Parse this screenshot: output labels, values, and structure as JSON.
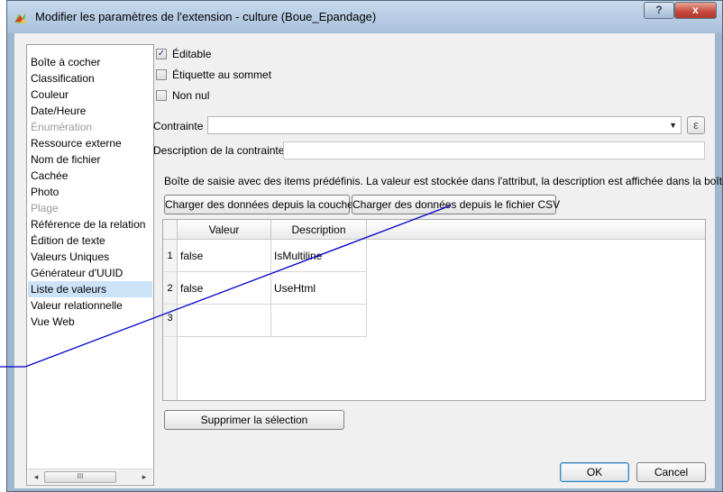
{
  "window": {
    "title": "Modifier les paramètres de l'extension - culture (Boue_Epandage)",
    "help_label": "?",
    "close_label": "x"
  },
  "widget_list": {
    "items": [
      {
        "label": "Boîte à cocher",
        "state": "normal"
      },
      {
        "label": "Classification",
        "state": "normal"
      },
      {
        "label": "Couleur",
        "state": "normal"
      },
      {
        "label": "Date/Heure",
        "state": "normal"
      },
      {
        "label": "Énumération",
        "state": "disabled"
      },
      {
        "label": "Ressource externe",
        "state": "normal"
      },
      {
        "label": "Nom de fichier",
        "state": "normal"
      },
      {
        "label": "Cachée",
        "state": "normal"
      },
      {
        "label": "Photo",
        "state": "normal"
      },
      {
        "label": "Plage",
        "state": "disabled"
      },
      {
        "label": "Référence de la relation",
        "state": "normal"
      },
      {
        "label": "Édition de texte",
        "state": "normal"
      },
      {
        "label": "Valeurs Uniques",
        "state": "normal"
      },
      {
        "label": "Générateur d'UUID",
        "state": "normal"
      },
      {
        "label": "Liste de valeurs",
        "state": "selected"
      },
      {
        "label": "Valeur relationnelle",
        "state": "normal"
      },
      {
        "label": "Vue Web",
        "state": "normal"
      }
    ],
    "scroll_thumb": "III"
  },
  "options": {
    "editable": {
      "label": "Éditable",
      "checked": true
    },
    "label_on_top": {
      "label": "Étiquette au sommet",
      "checked": false
    },
    "not_null": {
      "label": "Non nul",
      "checked": false
    }
  },
  "constraint": {
    "label": "Contrainte",
    "value": "",
    "expression_icon": "ε",
    "description_label": "Description de la contrainte",
    "description_value": ""
  },
  "value_map": {
    "hint": "Boîte de saisie avec des items prédéfinis. La valeur est stockée dans l'attribut, la description est affichée dans la boîte.",
    "load_from_layer": "Charger des données depuis la couche",
    "load_from_csv": "Charger des données depuis le fichier CSV",
    "headers": [
      "Valeur",
      "Description"
    ],
    "rows": [
      {
        "num": "1",
        "value": "false",
        "description": "IsMultiline"
      },
      {
        "num": "2",
        "value": "false",
        "description": "UseHtml"
      },
      {
        "num": "3",
        "value": "",
        "description": ""
      }
    ],
    "remove_selection": "Supprimer la sélection"
  },
  "footer": {
    "ok": "OK",
    "cancel": "Cancel"
  },
  "colors": {
    "annotation_line": "#0000cc",
    "selected_item": "#cde3f8",
    "close_button": "#c5473a"
  }
}
